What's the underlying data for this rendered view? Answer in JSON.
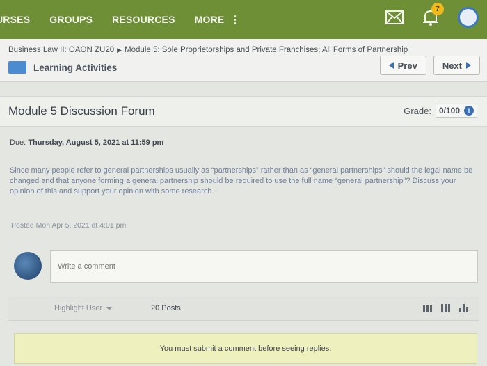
{
  "nav": {
    "items": [
      "URSES",
      "GROUPS",
      "RESOURCES",
      "MORE"
    ],
    "more_glyph": "⋮",
    "mail_icon": "envelope-icon",
    "notifications_icon": "bell-icon",
    "notification_count": "7",
    "colors": {
      "bar": "#6f8f36",
      "badge": "#f0b91c",
      "accent": "#3d6fb5"
    }
  },
  "breadcrumb": {
    "course": "Business Law II: OAON ZU20",
    "module": "Module 5: Sole Proprietorships and Private Franchises; All Forms of Partnership",
    "section": "Learning Activities"
  },
  "pager": {
    "prev": "Prev",
    "next": "Next"
  },
  "forum": {
    "title": "Module 5 Discussion Forum",
    "grade_label": "Grade:",
    "grade_value": "0/100",
    "info_glyph": "i"
  },
  "assignment": {
    "due_label": "Due:",
    "due_date": "Thursday, August 5, 2021 at 11:59 pm",
    "prompt": "Since many people refer to general partnerships usually as “partnerships” rather than as “general partnerships” should the legal name be changed and that anyone forming a general partnership should be required to use the full name “general partnership”? Discuss your opinion of this and support your opinion with some research.",
    "posted": "Posted Mon Apr 5, 2021 at 4:01 pm"
  },
  "composer": {
    "placeholder": "Write a comment"
  },
  "filter": {
    "highlight_user": "Highlight User",
    "posts_count": "20 Posts"
  },
  "notice": "You must submit a comment before seeing replies."
}
